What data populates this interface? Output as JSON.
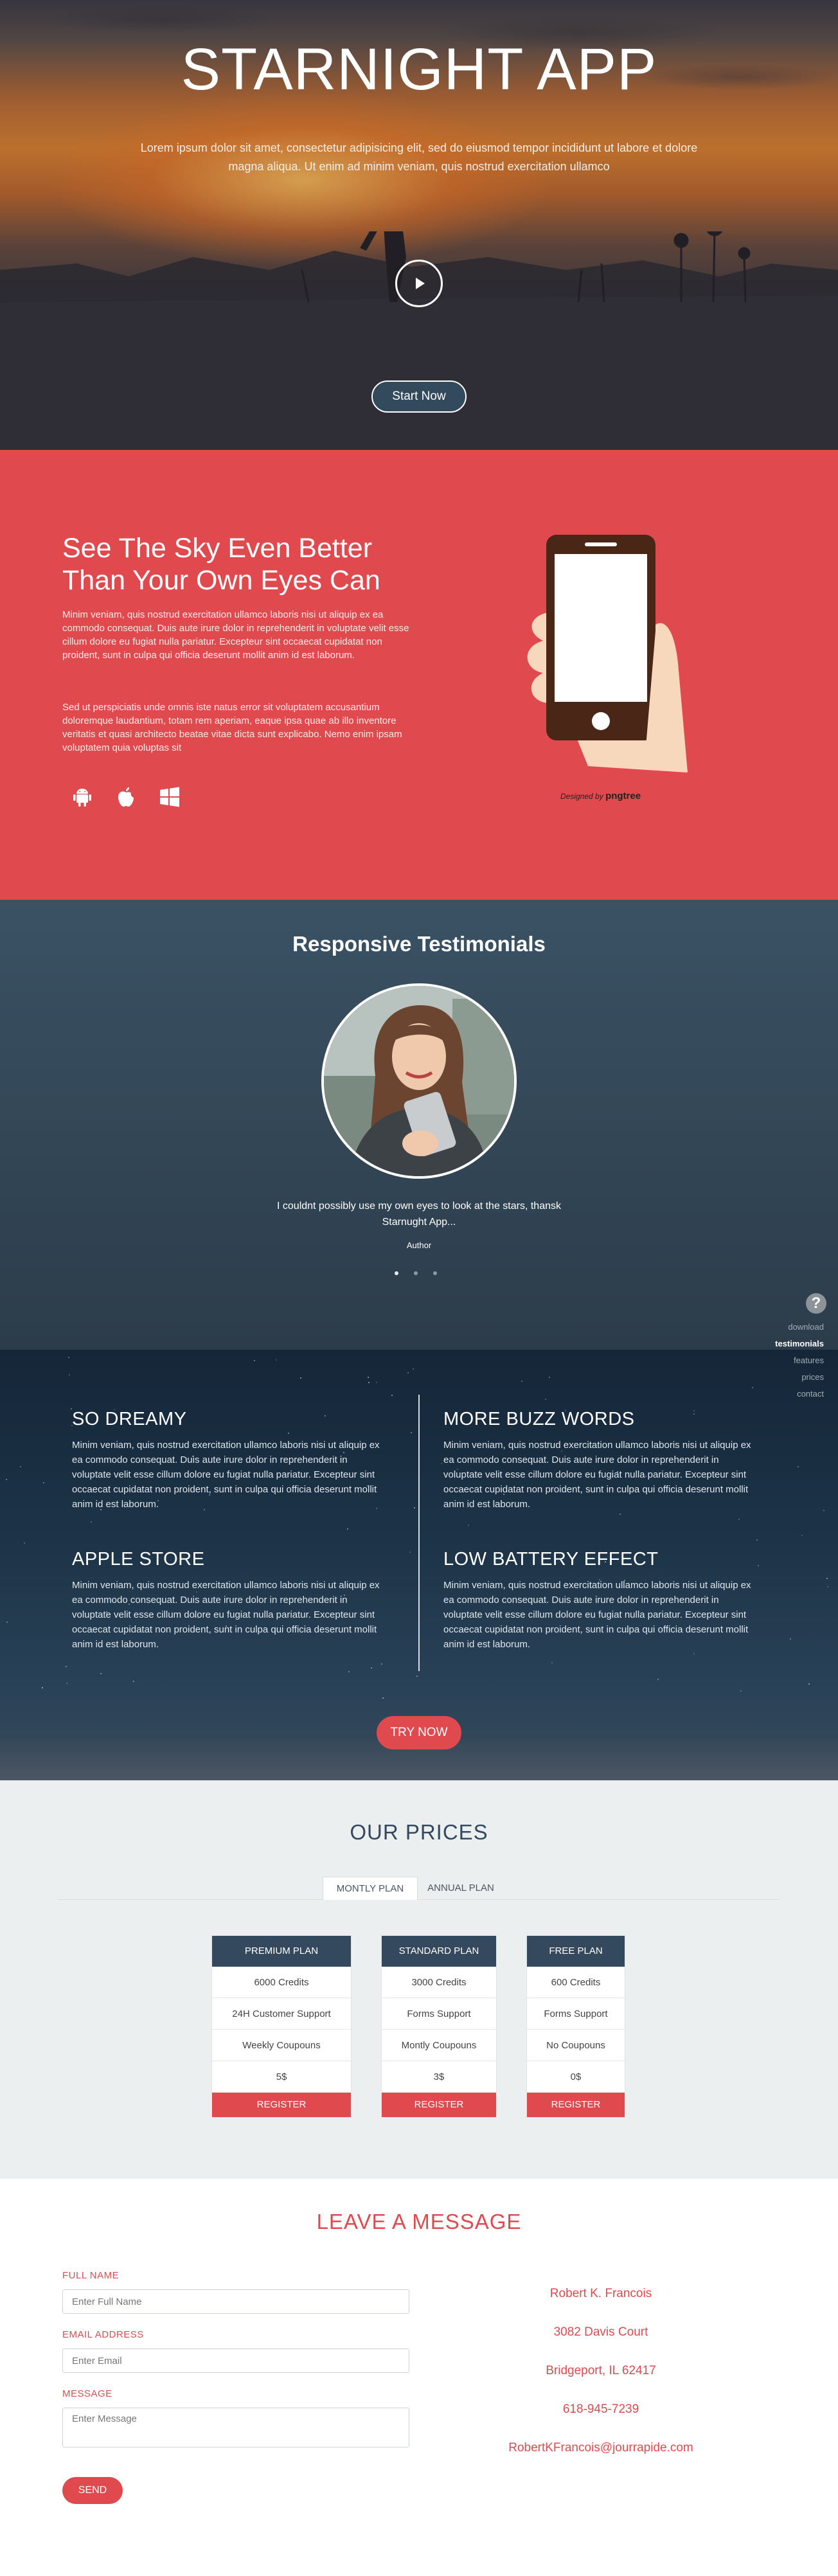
{
  "hero": {
    "title": "STARNIGHT APP",
    "text": "Lorem ipsum dolor sit amet, consectetur adipisicing elit, sed do eiusmod tempor incididunt ut labore et dolore magna aliqua. Ut enim ad minim veniam, quis nostrud exercitation ullamco",
    "play_icon": "play-icon",
    "start_label": "Start Now"
  },
  "feature": {
    "title": "See The Sky Even Better Than Your Own Eyes Can",
    "p1": "Minim veniam, quis nostrud exercitation ullamco laboris nisi ut aliquip ex ea commodo consequat. Duis aute irure dolor in reprehenderit in voluptate velit esse cillum dolore eu fugiat nulla pariatur. Excepteur sint occaecat cupidatat non proident, sunt in culpa qui officia deserunt mollit anim id est laborum.",
    "p2": "Sed ut perspiciatis unde omnis iste natus error sit voluptatem accusantium doloremque laudantium, totam rem aperiam, eaque ipsa quae ab illo inventore veritatis et quasi architecto beatae vitae dicta sunt explicabo. Nemo enim ipsam voluptatem quia voluptas sit",
    "icons": [
      "android-icon",
      "apple-icon",
      "windows-icon"
    ],
    "credit_prefix": "Designed by",
    "credit_brand": "pngtree"
  },
  "testimonials": {
    "title": "Responsive Testimonials",
    "quote": "I couldnt possibly use my own eyes to look at the stars, thansk Starnught App...",
    "author": "Author"
  },
  "sidenav": {
    "help": "?",
    "items": [
      "download",
      "testimonials",
      "features",
      "prices",
      "contact"
    ],
    "active": "testimonials"
  },
  "features": [
    {
      "title": "SO DREAMY",
      "text": "Minim veniam, quis nostrud exercitation ullamco laboris nisi ut aliquip ex ea commodo consequat. Duis aute irure dolor in reprehenderit in voluptate velit esse cillum dolore eu fugiat nulla pariatur. Excepteur sint occaecat cupidatat non proident, sunt in culpa qui officia deserunt mollit anim id est laborum."
    },
    {
      "title": "MORE BUZZ WORDS",
      "text": "Minim veniam, quis nostrud exercitation ullamco laboris nisi ut aliquip ex ea commodo consequat. Duis aute irure dolor in reprehenderit in voluptate velit esse cillum dolore eu fugiat nulla pariatur. Excepteur sint occaecat cupidatat non proident, sunt in culpa qui officia deserunt mollit anim id est laborum."
    },
    {
      "title": "APPLE STORE",
      "text": "Minim veniam, quis nostrud exercitation ullamco laboris nisi ut aliquip ex ea commodo consequat. Duis aute irure dolor in reprehenderit in voluptate velit esse cillum dolore eu fugiat nulla pariatur. Excepteur sint occaecat cupidatat non proident, sunt in culpa qui officia deserunt mollit anim id est laborum."
    },
    {
      "title": "LOW BATTERY EFFECT",
      "text": "Minim veniam, quis nostrud exercitation ullamco laboris nisi ut aliquip ex ea commodo consequat. Duis aute irure dolor in reprehenderit in voluptate velit esse cillum dolore eu fugiat nulla pariatur. Excepteur sint occaecat cupidatat non proident, sunt in culpa qui officia deserunt mollit anim id est laborum."
    }
  ],
  "try_label": "TRY NOW",
  "prices": {
    "title": "OUR PRICES",
    "tabs": [
      "MONTLY PLAN",
      "ANNUAL PLAN"
    ],
    "plans": [
      {
        "name": "PREMIUM PLAN",
        "rows": [
          "6000 Credits",
          "24H Customer Support",
          "Weekly Coupouns",
          "5$"
        ],
        "button": "REGISTER"
      },
      {
        "name": "STANDARD PLAN",
        "rows": [
          "3000 Credits",
          "Forms Support",
          "Montly Coupouns",
          "3$"
        ],
        "button": "REGISTER"
      },
      {
        "name": "FREE PLAN",
        "rows": [
          "600 Credits",
          "Forms Support",
          "No Coupouns",
          "0$"
        ],
        "button": "REGISTER"
      }
    ]
  },
  "contact": {
    "title": "LEAVE A MESSAGE",
    "name_label": "FULL NAME",
    "name_placeholder": "Enter Full Name",
    "email_label": "EMAIL ADDRESS",
    "email_placeholder": "Enter Email",
    "message_label": "MESSAGE",
    "message_placeholder": "Enter Message",
    "send_label": "SEND",
    "address": [
      "Robert K. Francois",
      "3082 Davis Court",
      "Bridgeport, IL 62417",
      "618-945-7239",
      "RobertKFrancois@jourrapide.com"
    ]
  },
  "colors": {
    "accent": "#e04a4e",
    "navy": "#34495e",
    "light_bg": "#eceff0"
  }
}
